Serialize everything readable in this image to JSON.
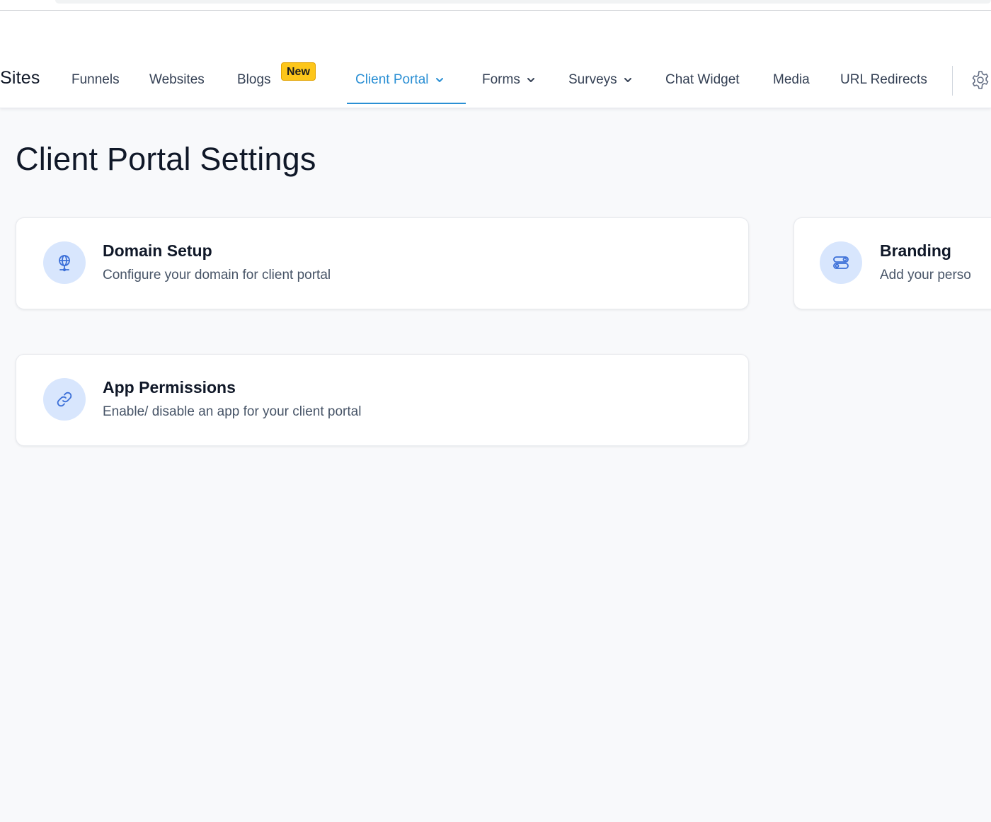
{
  "nav": {
    "brand": "Sites",
    "items": [
      {
        "label": "Funnels"
      },
      {
        "label": "Websites"
      },
      {
        "label": "Blogs",
        "badge": "New"
      },
      {
        "label": "Client Portal"
      },
      {
        "label": "Forms"
      },
      {
        "label": "Surveys"
      },
      {
        "label": "Chat Widget"
      },
      {
        "label": "Media"
      },
      {
        "label": "URL Redirects"
      }
    ],
    "active_item": "Client Portal",
    "settings_icon": "gear-icon"
  },
  "page": {
    "title": "Client Portal Settings"
  },
  "cards": [
    {
      "title": "Domain Setup",
      "description": "Configure your domain for client portal",
      "icon": "globe-icon"
    },
    {
      "title": "Branding",
      "description": "Add your perso",
      "icon": "toggle-icon"
    },
    {
      "title": "App Permissions",
      "description": "Enable/ disable an app for your client portal",
      "icon": "link-icon"
    }
  ],
  "colors": {
    "accent": "#2a8fd4",
    "badge": "#fdc61a",
    "icon_bg": "#d8e6fd",
    "icon_stroke": "#3b6fd8",
    "page_bg": "#f8f9fb"
  }
}
